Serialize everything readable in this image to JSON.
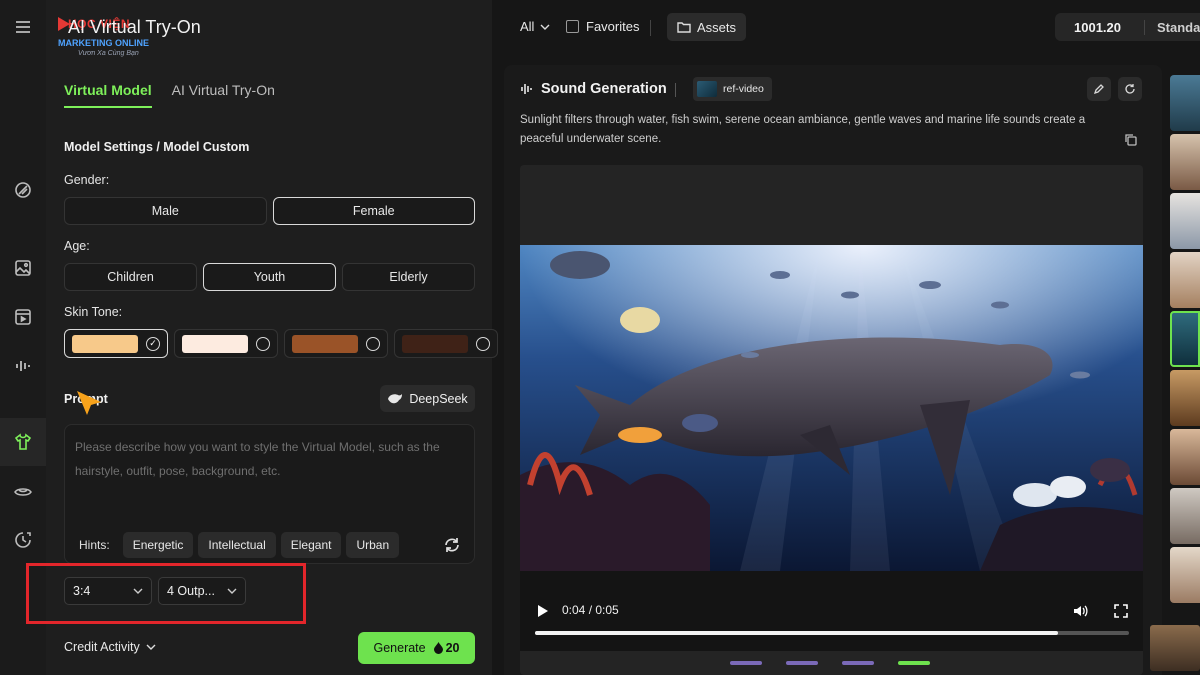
{
  "brand": {
    "line1": "HỌC VIỆN",
    "line2": "MARKETING ONLINE",
    "line3": "Vươn Xa Cùng Bạn"
  },
  "app": {
    "title": "AI Virtual Try-On"
  },
  "left_tabs": [
    {
      "label": "Virtual Model",
      "active": true
    },
    {
      "label": "AI Virtual Try-On",
      "active": false
    }
  ],
  "model": {
    "section_title": "Model Settings / Model Custom",
    "gender_label": "Gender:",
    "gender_options": [
      "Male",
      "Female"
    ],
    "gender_selected": "Female",
    "age_label": "Age:",
    "age_options": [
      "Children",
      "Youth",
      "Elderly"
    ],
    "age_selected": "Youth",
    "skin_label": "Skin Tone:",
    "skin_tones": [
      "#f7c98a",
      "#fdebe0",
      "#9a5328",
      "#3f2217"
    ],
    "skin_selected_index": 0
  },
  "prompt": {
    "label": "Prompt",
    "deepseek_label": "DeepSeek",
    "placeholder": "Please describe how you want to style the Virtual Model, such as the hairstyle, outfit, pose, background, etc.",
    "value": "",
    "hints_label": "Hints:",
    "hints": [
      "Energetic",
      "Intellectual",
      "Elegant",
      "Urban"
    ]
  },
  "settings": {
    "ratio": "3:4",
    "outputs": "4 Outp..."
  },
  "footer": {
    "credit_activity": "Credit Activity",
    "generate_label": "Generate",
    "generate_cost": "20"
  },
  "topbar": {
    "filter": "All",
    "favorites": "Favorites",
    "assets": "Assets",
    "credits": "1001.20",
    "plan": "Standa"
  },
  "result": {
    "title": "Sound Generation",
    "chip": "ref-video",
    "description": "Sunlight filters through water, fish swim, serene ocean ambiance, gentle waves and marine life sounds create a peaceful underwater scene.",
    "time": "0:04 / 0:05",
    "progress": 0.88
  },
  "colors": {
    "accent": "#6ee24e",
    "highlight": "#e3262b"
  },
  "icons": [
    "menu-icon",
    "brush-icon",
    "image-icon",
    "video-icon",
    "sound-icon",
    "shirt-icon",
    "eye-icon",
    "history-icon",
    "chevron-down-icon",
    "refresh-icon",
    "droplet-icon",
    "folder-icon",
    "edit-icon",
    "copy-icon",
    "play-icon",
    "volume-icon",
    "fullscreen-icon"
  ]
}
